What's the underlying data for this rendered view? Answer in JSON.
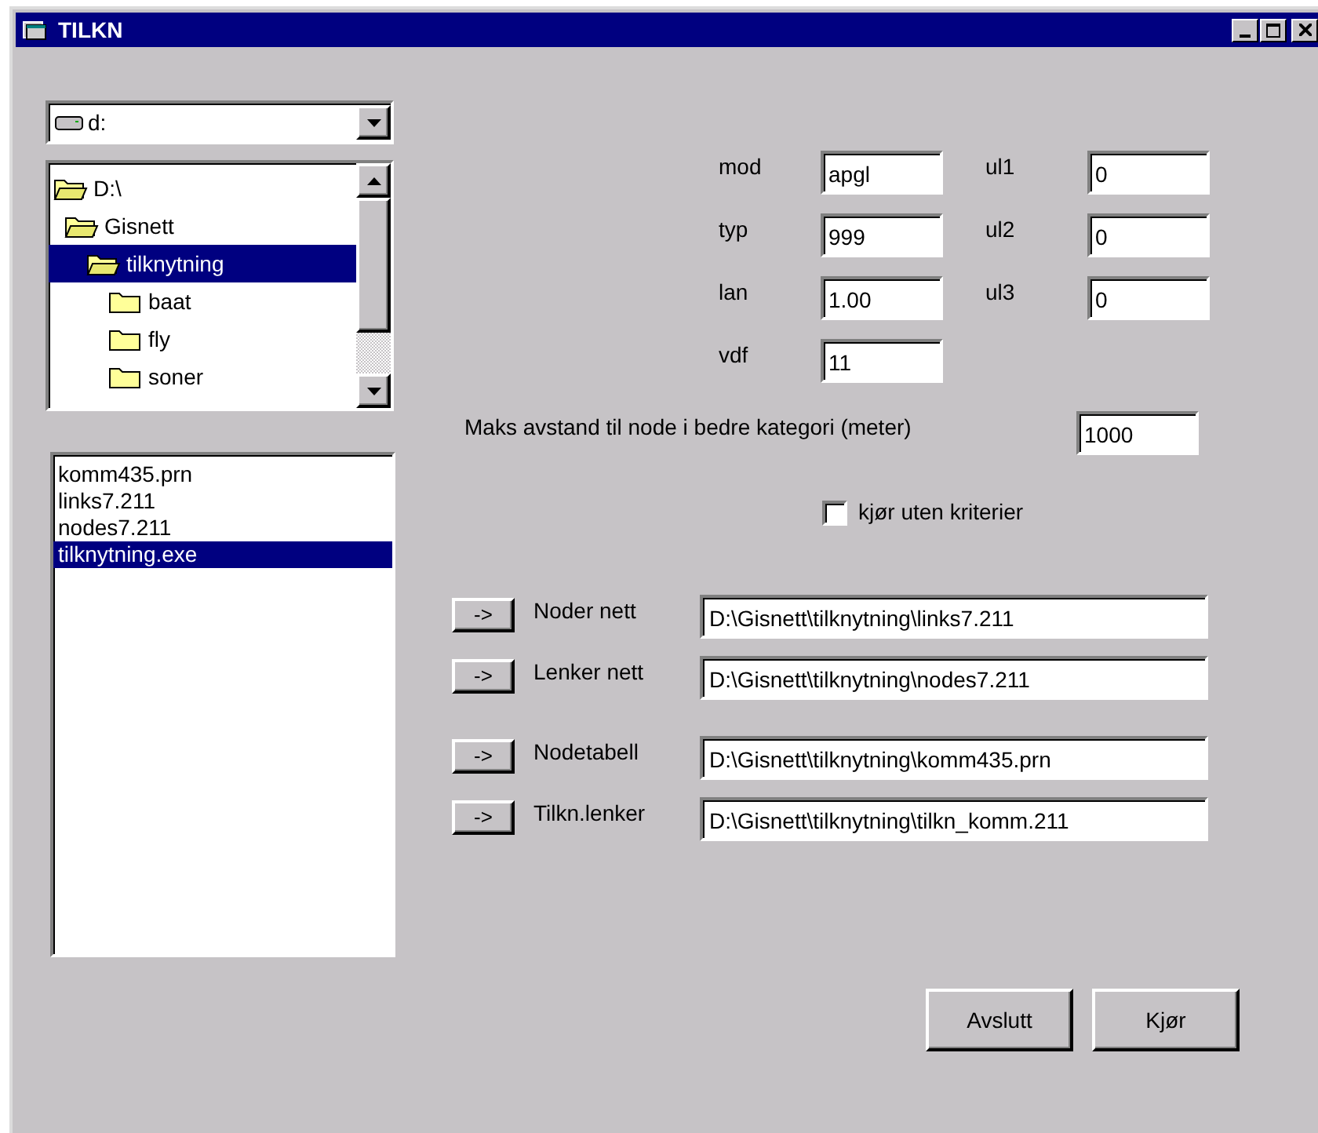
{
  "window": {
    "title": "TILKN"
  },
  "drive": {
    "value": "d:"
  },
  "directories": [
    {
      "name": "D:\\",
      "selected": false,
      "children": [
        {
          "name": "Gisnett",
          "selected": false,
          "children": [
            {
              "name": "tilknytning",
              "selected": true,
              "children": [
                {
                  "name": "baat",
                  "selected": false
                },
                {
                  "name": "fly",
                  "selected": false
                },
                {
                  "name": "soner",
                  "selected": false
                }
              ]
            }
          ]
        }
      ]
    }
  ],
  "files": [
    {
      "name": "komm435.prn",
      "selected": false
    },
    {
      "name": "links7.211",
      "selected": false
    },
    {
      "name": "nodes7.211",
      "selected": false
    },
    {
      "name": "tilknytning.exe",
      "selected": true
    }
  ],
  "parameters": [
    [
      {
        "label": "mod",
        "value": "apgl"
      },
      {
        "label": "typ",
        "value": "999"
      },
      {
        "label": "lan",
        "value": "1.00"
      },
      {
        "label": "vdf",
        "value": "11"
      }
    ],
    [
      {
        "label": "ul1",
        "value": "0"
      },
      {
        "label": "ul2",
        "value": "0"
      },
      {
        "label": "ul3",
        "value": "0"
      }
    ]
  ],
  "distance": {
    "label": "Maks avstand til node i bedre kategori (meter)",
    "value": "1000"
  },
  "option": {
    "label": "kjør uten kriterier",
    "checked": false
  },
  "path_groups": [
    [
      {
        "button": "->",
        "label": "Noder nett",
        "value": "D:\\Gisnett\\tilknytning\\links7.211"
      },
      {
        "button": "->",
        "label": "Lenker nett",
        "value": "D:\\Gisnett\\tilknytning\\nodes7.211"
      }
    ],
    [
      {
        "button": "->",
        "label": "Nodetabell",
        "value": "D:\\Gisnett\\tilknytning\\komm435.prn"
      },
      {
        "button": "->",
        "label": "Tilkn.lenker",
        "value": "D:\\Gisnett\\tilknytning\\tilkn_komm.211"
      }
    ]
  ],
  "buttons": [
    "Avslutt",
    "Kjør"
  ]
}
